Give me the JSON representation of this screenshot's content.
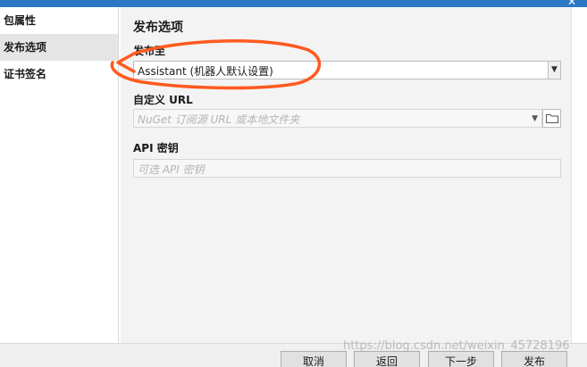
{
  "sidebar": {
    "items": [
      {
        "label": "包属性",
        "selected": false
      },
      {
        "label": "发布选项",
        "selected": true
      },
      {
        "label": "证书签名",
        "selected": false
      }
    ]
  },
  "main": {
    "section_title": "发布选项",
    "publish_to": {
      "label": "发布至",
      "value": "Assistant (机器人默认设置)"
    },
    "custom_url": {
      "label": "自定义 URL",
      "placeholder": "NuGet 订阅源 URL 或本地文件夹"
    },
    "api_key": {
      "label": "API 密钥",
      "placeholder": "可选 API 密钥"
    }
  },
  "footer": {
    "cancel_label": "取消",
    "back_label": "返回",
    "next_label": "下一步",
    "publish_label": "发布"
  },
  "watermark": "https://blog.csdn.net/weixin_45728196",
  "colors": {
    "annotation": "#ff5a1f",
    "titlebar": "#2b78c5"
  }
}
